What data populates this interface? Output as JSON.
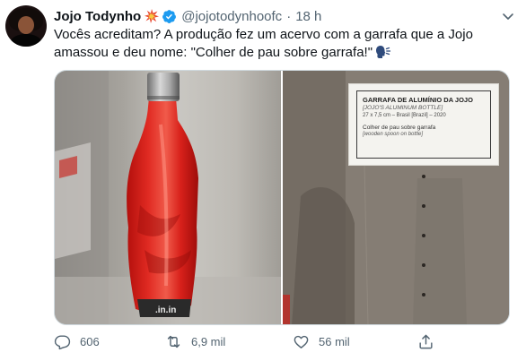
{
  "tweet": {
    "author_name": "Jojo Todynho",
    "author_handle": "@jojotodynhoofc",
    "separator": "·",
    "time": "18 h",
    "text": "Vocês acreditam? A produção fez um acervo com a garrafa que a Jojo amassou e deu nome: \"Colher de pau sobre garrafa!\"",
    "icons": {
      "name_emoji": "collision-emoji-icon",
      "verified": "verified-badge-icon",
      "more": "chevron-down-icon",
      "text_emoji": "speaking-head-icon"
    }
  },
  "media": {
    "left_photo": {
      "description_icon": "red-bottle-photo",
      "bottle_label_text": ".in.in"
    },
    "right_photo": {
      "museum_label": {
        "title": "GARRAFA DE ALUMÍNIO DA JOJO",
        "subtitle": "[JOJO'S ALUMINUM BOTTLE]",
        "meta": "27 x 7,5 cm – Brasil [Brazil] – 2020",
        "piece_name": "Colher de pau sobre garrafa",
        "piece_name_en": "[wooden spoon on bottle]"
      }
    }
  },
  "actions": {
    "reply_count": "606",
    "retweet_count": "6,9 mil",
    "like_count": "56 mil",
    "share_label": ""
  },
  "colors": {
    "text_primary": "#0f1419",
    "text_secondary": "#536471",
    "verified_blue": "#1d9bf0",
    "bottle_red": "#e0221c"
  }
}
